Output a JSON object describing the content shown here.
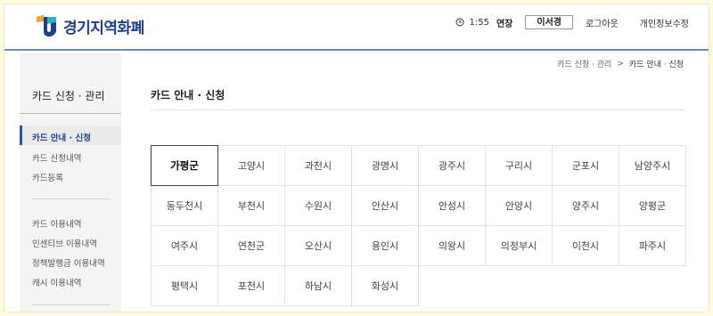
{
  "header": {
    "logo_text": "경기지역화폐",
    "session_time": "1:55",
    "extend_label": "연장",
    "user_name": "이서경",
    "logout_label": "로그아웃",
    "profile_label": "개인정보수정"
  },
  "sidebar": {
    "title": "카드 신청 · 관리",
    "group1": [
      {
        "label": "카드 안내 · 신청",
        "active": true
      },
      {
        "label": "카드 신청내역",
        "active": false
      },
      {
        "label": "카드등록",
        "active": false
      }
    ],
    "group2": [
      {
        "label": "카드 이용내역"
      },
      {
        "label": "인센티브 이용내역"
      },
      {
        "label": "정책발행금 이용내역"
      },
      {
        "label": "캐시 이용내역"
      }
    ]
  },
  "breadcrumb": {
    "parent": "카드 신청 · 관리",
    "separator": ">",
    "current": "카드 안내 · 신청"
  },
  "page_title": "카드 안내 · 신청",
  "regions": [
    "가평군",
    "고양시",
    "과천시",
    "광명시",
    "광주시",
    "구리시",
    "군포시",
    "남양주시",
    "동두천시",
    "부천시",
    "수원시",
    "안산시",
    "안성시",
    "안양시",
    "양주시",
    "양평군",
    "여주시",
    "연천군",
    "오산시",
    "용인시",
    "의왕시",
    "의정부시",
    "이천시",
    "파주시",
    "평택시",
    "포천시",
    "하남시",
    "화성시"
  ],
  "selected_region": "가평군",
  "colors": {
    "brand_blue": "#1d3f8a",
    "header_line": "#6a8fba",
    "page_background": "#fffbe0"
  }
}
